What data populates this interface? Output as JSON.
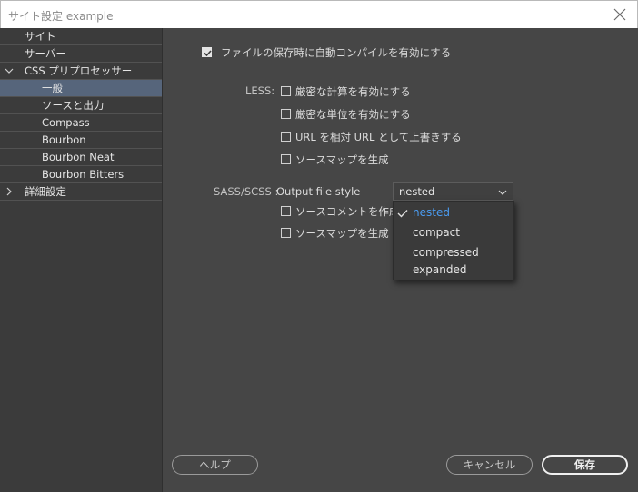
{
  "window": {
    "title": "サイト設定 example",
    "close_icon": "close-icon"
  },
  "sidebar": {
    "items": [
      {
        "label": "サイト",
        "level": 0,
        "selected": false
      },
      {
        "label": "サーバー",
        "level": 0,
        "selected": false
      },
      {
        "label": "CSS プリプロセッサー",
        "level": 0,
        "expanded": true,
        "selected": false
      },
      {
        "label": "一般",
        "level": 1,
        "selected": true
      },
      {
        "label": "ソースと出力",
        "level": 1,
        "selected": false
      },
      {
        "label": "Compass",
        "level": 1,
        "selected": false
      },
      {
        "label": "Bourbon",
        "level": 1,
        "selected": false
      },
      {
        "label": "Bourbon Neat",
        "level": 1,
        "selected": false
      },
      {
        "label": "Bourbon Bitters",
        "level": 1,
        "selected": false
      },
      {
        "label": "詳細設定",
        "level": 0,
        "expanded": false,
        "selected": false
      }
    ],
    "selected_bg": "#56657b"
  },
  "main": {
    "autocompile": {
      "label": "ファイルの保存時に自動コンパイルを有効にする",
      "checked": true
    },
    "less": {
      "label": "LESS:",
      "options": [
        {
          "label": "厳密な計算を有効にする",
          "checked": false
        },
        {
          "label": "厳密な単位を有効にする",
          "checked": false
        },
        {
          "label": "URL を相対 URL として上書きする",
          "checked": false
        },
        {
          "label": "ソースマップを生成",
          "checked": false
        }
      ]
    },
    "sass": {
      "label": "SASS/SCSS :",
      "output_style_label": "Output file style",
      "selected": "nested",
      "dropdown_options": [
        "nested",
        "compact",
        "compressed",
        "expanded"
      ],
      "options": [
        {
          "label": "ソースコメントを作成",
          "checked": false
        },
        {
          "label": "ソースマップを生成",
          "checked": false
        }
      ]
    }
  },
  "footer": {
    "help": "ヘルプ",
    "cancel": "キャンセル",
    "save": "保存"
  },
  "colors": {
    "accent": "#4a9bf0",
    "panel": "#464646",
    "sidebar": "#3b3b3b"
  }
}
